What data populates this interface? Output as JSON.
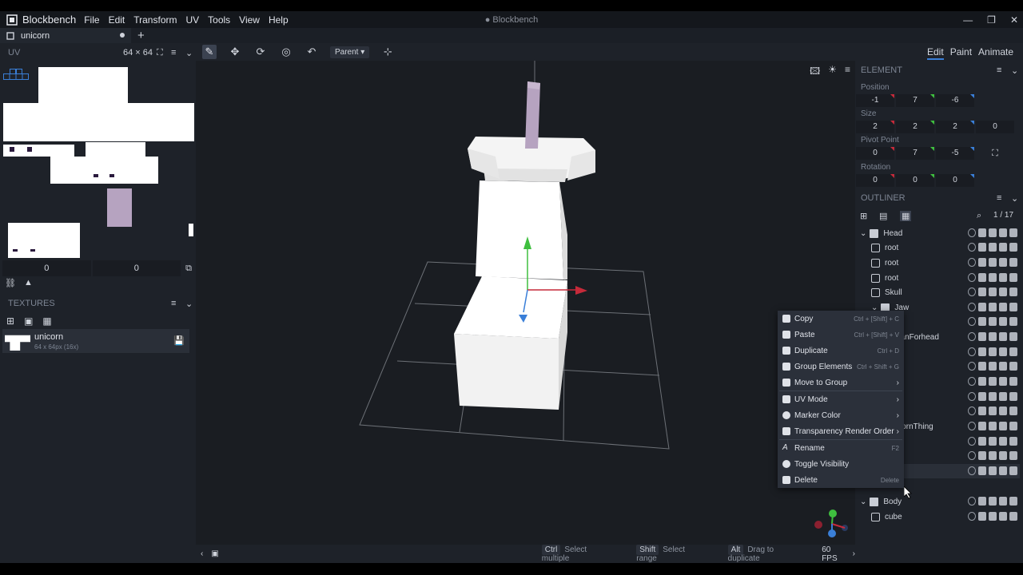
{
  "app": {
    "name": "Blockbench",
    "window_title": "Blockbench",
    "menu": [
      "File",
      "Edit",
      "Transform",
      "UV",
      "Tools",
      "View",
      "Help"
    ]
  },
  "tab": {
    "label": "unicorn"
  },
  "uv": {
    "title": "UV",
    "size": "64 × 64",
    "offset_x": "0",
    "offset_y": "0"
  },
  "textures": {
    "title": "TEXTURES",
    "item_name": "unicorn",
    "item_meta": "64 x 64px (16x)"
  },
  "toolbar": {
    "transform_space": "Parent"
  },
  "status": {
    "hint1_key": "Ctrl",
    "hint1_text": "Select multiple",
    "hint2_key": "Shift",
    "hint2_text": "Select range",
    "hint3_key": "Alt",
    "hint3_text": "Drag to duplicate",
    "fps": "60 FPS"
  },
  "modes": [
    "Edit",
    "Paint",
    "Animate"
  ],
  "element": {
    "title": "ELEMENT",
    "position_label": "Position",
    "position": [
      "-1",
      "7",
      "-6"
    ],
    "size_label": "Size",
    "size": [
      "2",
      "2",
      "2",
      "0"
    ],
    "pivot_label": "Pivot Point",
    "pivot": [
      "0",
      "7",
      "-5"
    ],
    "rotation_label": "Rotation",
    "rotation": [
      "0",
      "0",
      "0"
    ]
  },
  "outliner": {
    "title": "OUTLINER",
    "count": "1 / 17",
    "rows": [
      {
        "label": "Head",
        "kind": "group"
      },
      {
        "label": "root",
        "kind": "cube"
      },
      {
        "label": "root",
        "kind": "cube"
      },
      {
        "label": "root",
        "kind": "cube"
      },
      {
        "label": "Skull",
        "kind": "cube"
      },
      {
        "label": "Jaw",
        "kind": "group"
      },
      {
        "label": "w",
        "kind": "cube"
      },
      {
        "label": "eanForhead",
        "kind": "cube"
      },
      {
        "label": "",
        "kind": "cube"
      },
      {
        "label": "",
        "kind": "cube"
      },
      {
        "label": "",
        "kind": "cube"
      },
      {
        "label": "",
        "kind": "cube"
      },
      {
        "label": "",
        "kind": "cube"
      },
      {
        "label": "HornThing",
        "kind": "cube"
      },
      {
        "label": "",
        "kind": "cube"
      },
      {
        "label": "",
        "kind": "cube"
      },
      {
        "label": "",
        "kind": "cube"
      },
      {
        "label": "Body",
        "kind": "group"
      },
      {
        "label": "cube",
        "kind": "cube"
      }
    ]
  },
  "context_menu": {
    "items": [
      {
        "label": "Copy",
        "shortcut": "Ctrl + [Shift] + C"
      },
      {
        "label": "Paste",
        "shortcut": "Ctrl + [Shift] + V"
      },
      {
        "label": "Duplicate",
        "shortcut": "Ctrl + D"
      },
      {
        "label": "Group Elements",
        "shortcut": "Ctrl + Shift + G"
      },
      {
        "label": "Move to Group",
        "shortcut": ""
      },
      {
        "label": "UV Mode",
        "shortcut": ""
      },
      {
        "label": "Marker Color",
        "shortcut": ""
      },
      {
        "label": "Transparency Render Order",
        "shortcut": ""
      },
      {
        "label": "Rename",
        "shortcut": "F2"
      },
      {
        "label": "Toggle Visibility",
        "shortcut": ""
      },
      {
        "label": "Delete",
        "shortcut": "Delete"
      }
    ]
  },
  "colors": {
    "accent": "#3a7fd8",
    "x_axis": "#c62a3a",
    "y_axis": "#3fbf3f",
    "z_axis": "#3a7fd8",
    "horn": "#b6a3c0"
  }
}
